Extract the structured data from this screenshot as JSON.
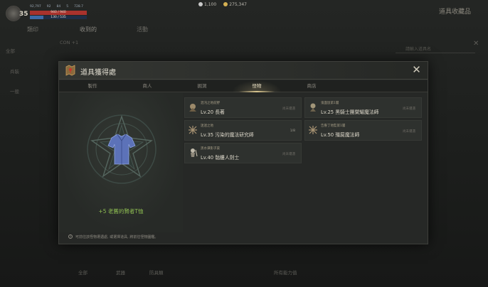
{
  "hud": {
    "level": "35",
    "stats": [
      "92,797",
      "92",
      "84",
      "5",
      "728.7"
    ],
    "hp_text": "940 / 940",
    "mp_text": "130 / 535",
    "currency_1": "1,100",
    "currency_2": "275,347",
    "page_title": "道具收藏品"
  },
  "background": {
    "tabs": [
      "類印",
      "收到的",
      "活動"
    ],
    "search_placeholder": "請輸入道具名",
    "filter_label": "CON +1",
    "side_items": [
      "全部",
      "兵裝",
      "一般"
    ],
    "bottom_items": [
      "全部",
      "武器",
      "防具類",
      "所有能力值"
    ]
  },
  "modal": {
    "title": "道具獲得處",
    "close_glyph": "✕",
    "tabs": [
      "製作",
      "商人",
      "掘洞",
      "怪物",
      "商店"
    ],
    "active_tab": "怪物",
    "item_name": "+5 老舊的賢者T恤",
    "footer_note": "可前往該怪物遭遇處, 或選擇道具, 將前往怪物圖鑑。",
    "entries": [
      {
        "location": "混沌之地前野",
        "monster": "Lv.20 長著",
        "side": "尚未遭遇"
      },
      {
        "location": "迷迷之地",
        "monster": "Lv.35 污染的魔法研究師",
        "side": "1/8"
      },
      {
        "location": "黑水潭影子渠",
        "monster": "Lv.40 骷髏人劍士",
        "side": "尚未遭遇"
      },
      {
        "location": "鬼面鼠第1層",
        "monster": "Lv.25 黑騎士團榮耀魔法師",
        "side": "尚未遭遇"
      },
      {
        "location": "告魯丁地監第1層",
        "monster": "Lv.50 殭屍魔法師",
        "side": "尚未遭遇"
      }
    ]
  },
  "colors": {
    "accent_gold": "#d8c48e",
    "item_green": "#8fbf52",
    "panel": "#262826"
  }
}
